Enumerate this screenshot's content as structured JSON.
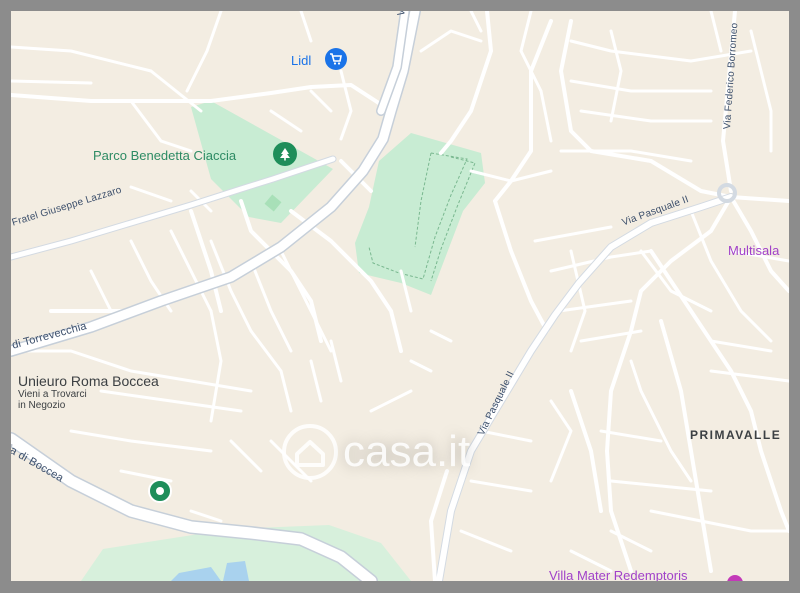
{
  "map": {
    "places": {
      "lidl": "Lidl",
      "parco": "Parco Benedetta Ciaccia",
      "multisala": "Multisala",
      "unieuro": "Unieuro Roma Boccea",
      "unieuro_sub1": "Vieni a Trovarci",
      "unieuro_sub2": "in Negozio",
      "primavalle": "PRIMAVALLE",
      "villa": "Villa Mater Redemptoris"
    },
    "roads": {
      "fratel": "Fratel Giuseppe Lazzaro",
      "torrevecchia": "di Torrevecchia",
      "pasquale_upper": "Via Pasquale II",
      "pasquale_lower": "Via Pasquale II",
      "borromeo": "Via Federico Borromeo",
      "boccea": "ia di Boccea",
      "top_v": "V"
    },
    "watermark": "casa.it",
    "colors": {
      "land": "#f3ede2",
      "park": "#c8ecd3",
      "road": "#ffffff",
      "major_road": "#c6cfd9",
      "pin_green": "#1e8e5a",
      "pin_blue": "#1a73e8",
      "pin_purple": "#c33ab8"
    },
    "icons": [
      "shopping-cart-icon",
      "tree-icon",
      "location-pin-icon"
    ]
  }
}
